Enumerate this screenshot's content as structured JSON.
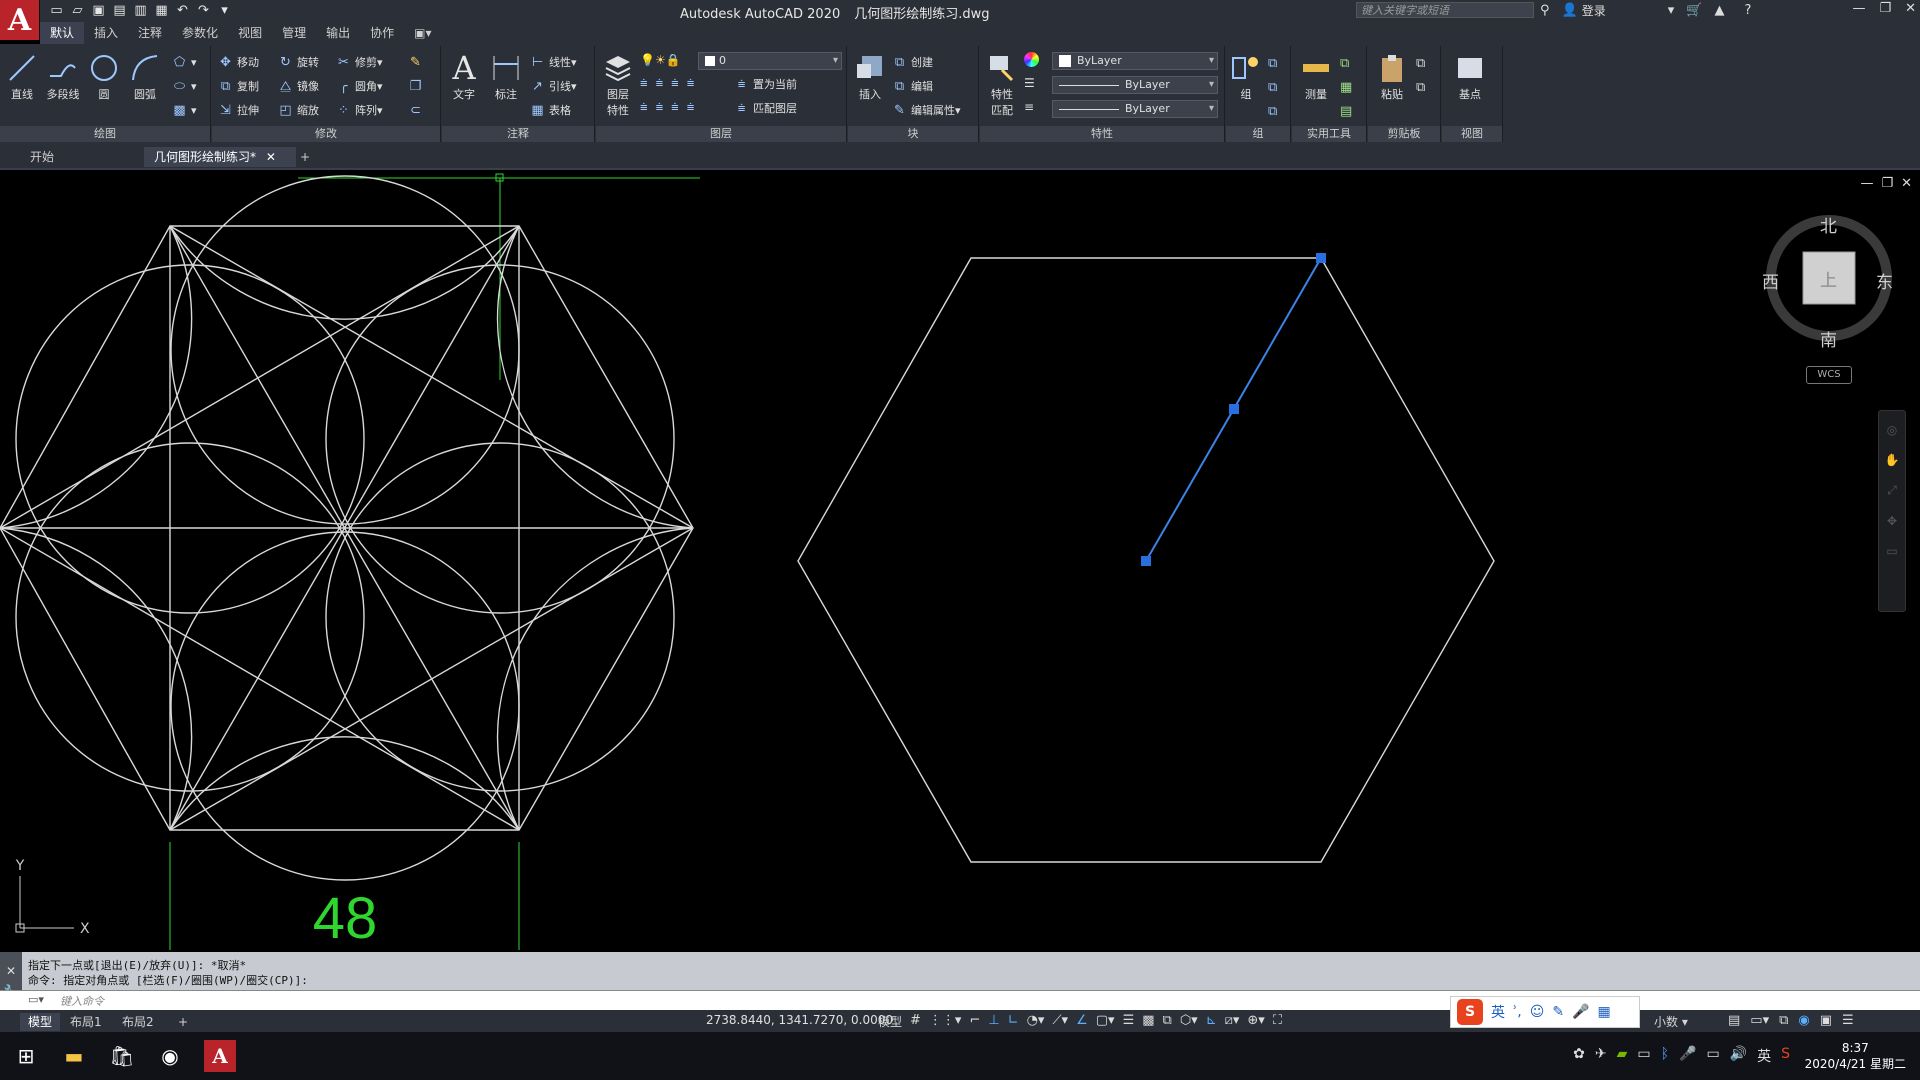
{
  "app": {
    "logo": "A",
    "product": "Autodesk AutoCAD 2020",
    "filename": "几何图形绘制练习.dwg",
    "search_placeholder": "键入关键字或短语",
    "login": "登录"
  },
  "quick_access": [
    "new-icon",
    "open-icon",
    "save-icon",
    "saveas-icon",
    "webmobile-icon",
    "plot-icon",
    "undo-icon",
    "redo-icon",
    "customize-icon"
  ],
  "ribbon_tabs": [
    "默认",
    "插入",
    "注释",
    "参数化",
    "视图",
    "管理",
    "输出",
    "协作"
  ],
  "active_ribbon_tab": "默认",
  "draw_panel": {
    "title": "绘图",
    "tools": [
      "直线",
      "多段线",
      "圆",
      "圆弧"
    ]
  },
  "modify_panel": {
    "title": "修改",
    "row1": [
      "移动",
      "旋转",
      "修剪"
    ],
    "row2": [
      "复制",
      "镜像",
      "圆角"
    ],
    "row3": [
      "拉伸",
      "缩放",
      "阵列"
    ]
  },
  "annotation_panel": {
    "title": "注释",
    "big": [
      "文字",
      "标注"
    ],
    "small": [
      "线性",
      "引线",
      "表格"
    ]
  },
  "layers_panel": {
    "title": "图层",
    "big": "图层\n特性",
    "layer_value": "0",
    "actions": [
      "置为当前",
      "匹配图层"
    ]
  },
  "block_panel": {
    "title": "块",
    "big": "插入",
    "actions": [
      "创建",
      "编辑",
      "编辑属性"
    ]
  },
  "properties_panel": {
    "title": "特性",
    "big": "特性\n匹配",
    "color": "ByLayer",
    "linetype": "ByLayer",
    "lineweight": "ByLayer"
  },
  "group_panel": {
    "title": "组",
    "big": "组"
  },
  "utilities_panel": {
    "title": "实用工具",
    "big": "测量"
  },
  "clipboard_panel": {
    "title": "剪贴板",
    "big": "粘贴"
  },
  "view_panel": {
    "title": "视图",
    "big": "基点"
  },
  "doc_tabs": [
    "开始",
    "几何图形绘制练习*"
  ],
  "active_doc_tab": "几何图形绘制练习*",
  "viewcube": {
    "north": "北",
    "south": "南",
    "east": "东",
    "west": "西",
    "face": "上",
    "wcs": "WCS"
  },
  "dimension_text": "48",
  "ucs": {
    "x": "X",
    "y": "Y"
  },
  "command_history": [
    "指定下一点或[退出(E)/放弃(U)]: *取消*",
    "命令: 指定对角点或 [栏选(F)/圈围(WP)/圈交(CP)]:"
  ],
  "command_placeholder": "键入命令",
  "layout_tabs": [
    "模型",
    "布局1",
    "布局2"
  ],
  "active_layout_tab": "模型",
  "coordinates": "2738.8440, 1341.7270, 0.0000",
  "status_model": "模型",
  "units_label": "小数",
  "ime": {
    "lang": "英",
    "logo": "S"
  },
  "taskbar": {
    "time": "8:37",
    "date": "2020/4/21 星期二",
    "tray_lang": "英"
  },
  "colors": {
    "accent_blue": "#3b83e8",
    "dimension_green": "#2fd62f",
    "geometry_white": "#d9d9d9",
    "logo_red": "#b8242a"
  }
}
